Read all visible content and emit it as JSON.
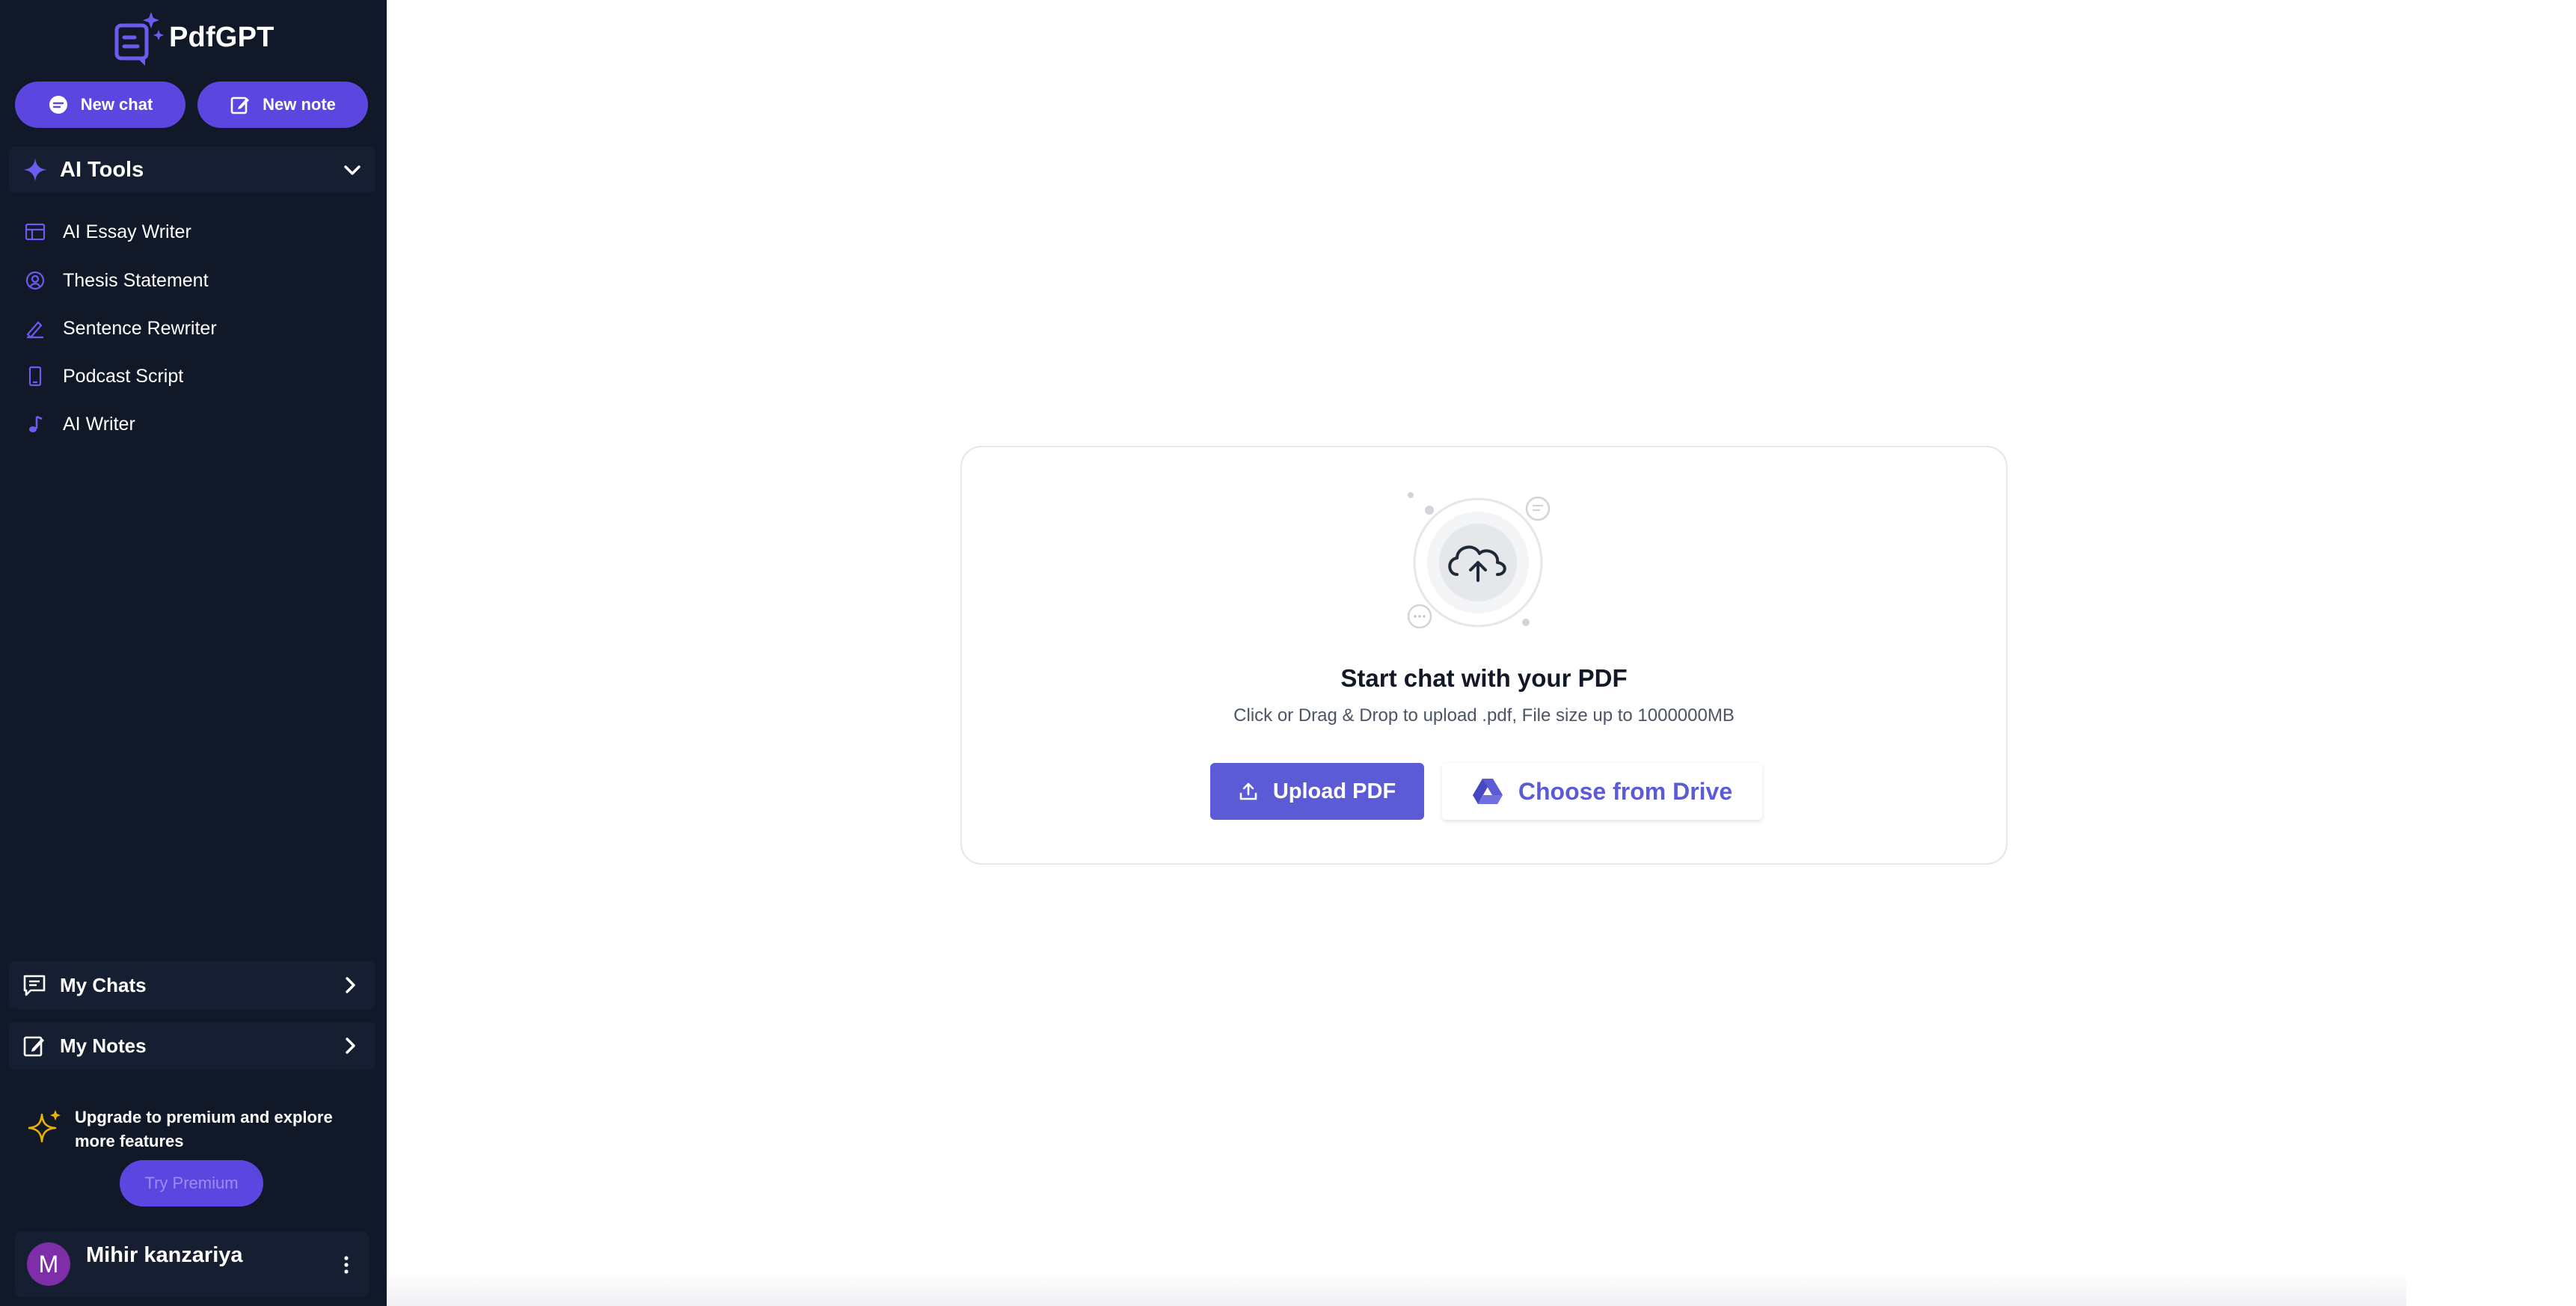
{
  "app": {
    "name": "PdfGPT"
  },
  "sidebar": {
    "new_chat_label": "New chat",
    "new_note_label": "New note",
    "tools_section": {
      "label": "AI Tools",
      "items": [
        {
          "label": "AI Essay Writer",
          "icon": "table-icon"
        },
        {
          "label": "Thesis Statement",
          "icon": "badge-icon"
        },
        {
          "label": "Sentence Rewriter",
          "icon": "pen-icon"
        },
        {
          "label": "Podcast Script",
          "icon": "phone-icon"
        },
        {
          "label": "AI Writer",
          "icon": "music-note-icon"
        }
      ]
    },
    "my_chats_label": "My Chats",
    "my_notes_label": "My Notes",
    "upgrade": {
      "text": "Upgrade to premium and explore more features",
      "button_label": "Try Premium"
    },
    "user": {
      "initial": "M",
      "name": "Mihir kanzariya"
    }
  },
  "upload": {
    "title": "Start chat with your PDF",
    "subtitle": "Click or Drag & Drop to upload .pdf, File size up to 1000000MB",
    "upload_button_label": "Upload PDF",
    "drive_button_label": "Choose from Drive"
  },
  "colors": {
    "sidebar_bg": "#111827",
    "accent": "#5b47e0",
    "primary_button": "#5b5bd6"
  }
}
